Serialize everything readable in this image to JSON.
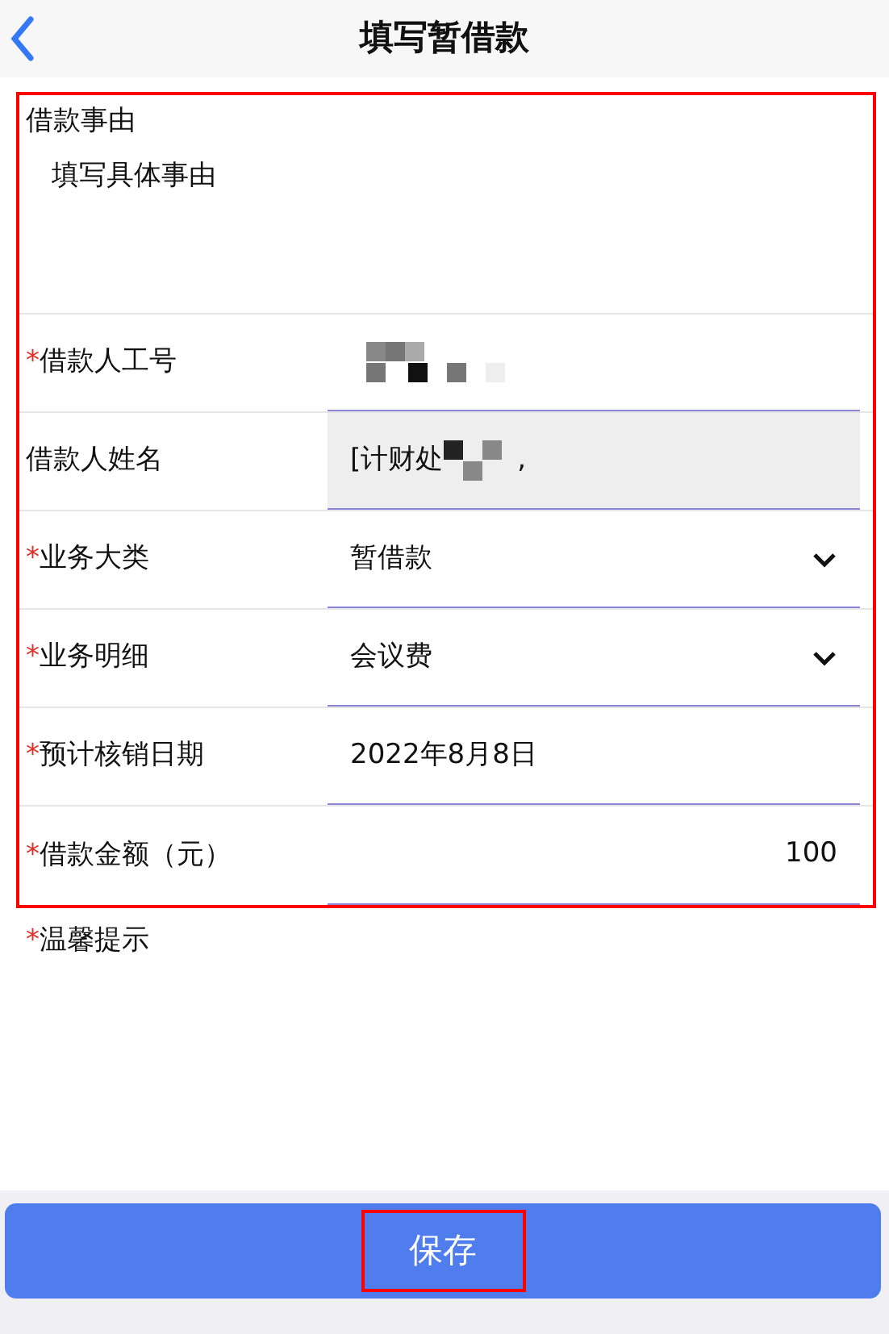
{
  "header": {
    "title": "填写暂借款"
  },
  "form": {
    "highlighted": true,
    "reason": {
      "label": "借款事由",
      "value": "填写具体事由"
    },
    "rows": [
      {
        "kind": "redacted",
        "mark": "*",
        "label": "借款人工号"
      },
      {
        "kind": "readonly",
        "label": "借款人姓名",
        "value_prefix": "[计财处",
        "value_suffix": ","
      },
      {
        "kind": "select",
        "mark": "*",
        "label": "业务大类",
        "value": "暂借款"
      },
      {
        "kind": "select",
        "mark": "*",
        "label": "业务明细",
        "value": "会议费"
      },
      {
        "kind": "text",
        "mark": "*",
        "label": "预计核销日期",
        "value": "2022年8月8日"
      },
      {
        "kind": "amount",
        "mark": "*",
        "label": "借款金额（元）",
        "value": "100"
      }
    ]
  },
  "notice": {
    "mark": "*",
    "label": "温馨提示"
  },
  "save_button": {
    "label": "保存",
    "highlighted": true
  }
}
